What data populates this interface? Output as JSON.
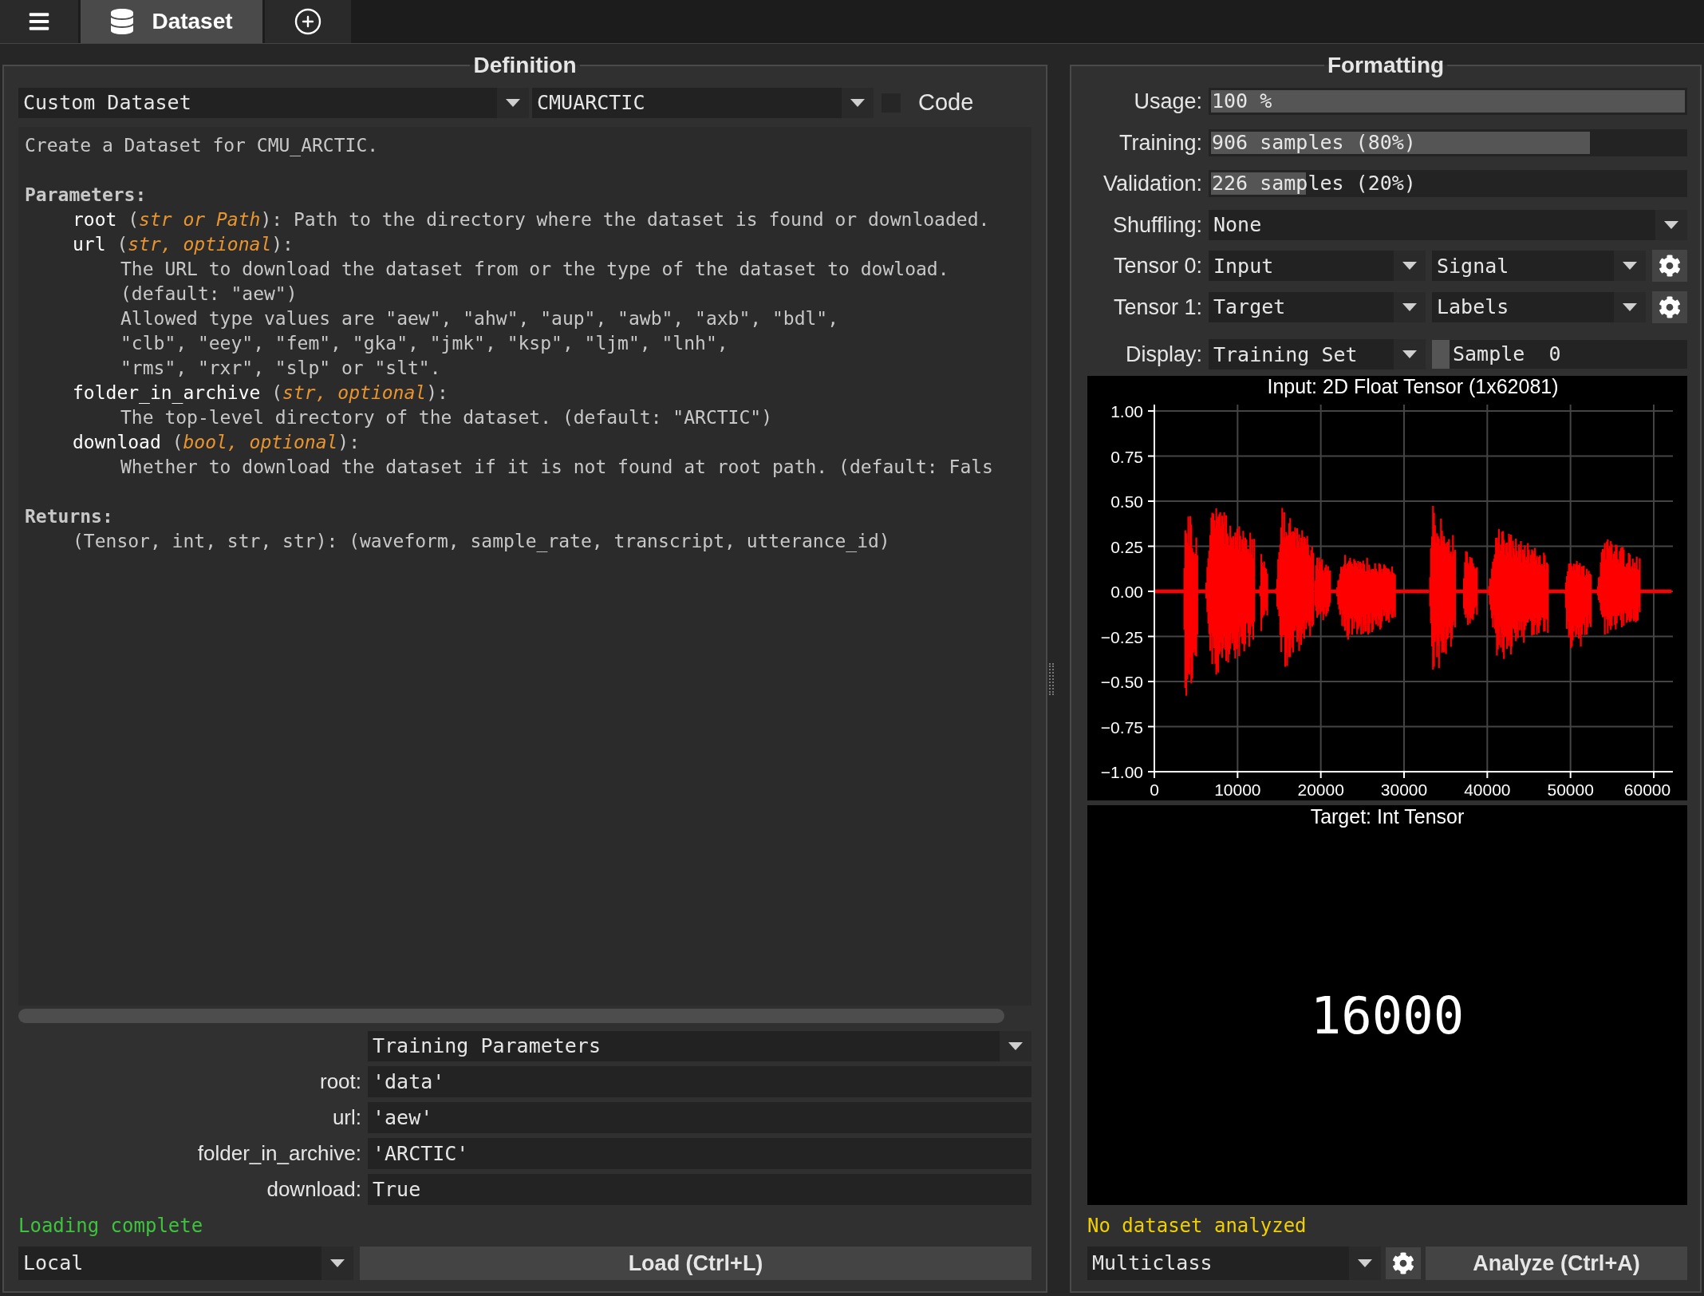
{
  "toolbar": {
    "tabs": [
      {
        "label": "Dataset",
        "selected": true
      }
    ]
  },
  "definition": {
    "title": "Definition",
    "dataset_type": "Custom Dataset",
    "dataset": "CMUARCTIC",
    "code": {
      "label": "Code",
      "checked": false
    },
    "docstring": [
      {
        "parts": [
          {
            "kind": "plain",
            "text": "Create a Dataset for CMU_ARCTIC."
          }
        ]
      },
      {
        "gap_before": true,
        "parts": [
          {
            "kind": "heading",
            "text": "Parameters:"
          }
        ],
        "children": [
          {
            "parts": [
              {
                "kind": "name",
                "text": "root"
              },
              {
                "kind": "plain",
                "text": " ("
              },
              {
                "kind": "type",
                "text": "str or Path"
              },
              {
                "kind": "plain",
                "text": "): Path to the directory where the dataset is found or downloaded."
              }
            ]
          },
          {
            "parts": [
              {
                "kind": "name",
                "text": "url"
              },
              {
                "kind": "plain",
                "text": " ("
              },
              {
                "kind": "type",
                "text": "str, optional"
              },
              {
                "kind": "plain",
                "text": "):"
              }
            ],
            "children": [
              {
                "parts": [
                  {
                    "kind": "plain",
                    "text": "The URL to download the dataset from or the type of the dataset to dowload."
                  }
                ]
              },
              {
                "parts": [
                  {
                    "kind": "plain",
                    "text": "(default: \"aew\")"
                  }
                ]
              },
              {
                "parts": [
                  {
                    "kind": "plain",
                    "text": "Allowed type values are \"aew\", \"ahw\", \"aup\", \"awb\", \"axb\", \"bdl\","
                  }
                ]
              },
              {
                "parts": [
                  {
                    "kind": "plain",
                    "text": "\"clb\", \"eey\", \"fem\", \"gka\", \"jmk\", \"ksp\", \"ljm\", \"lnh\","
                  }
                ]
              },
              {
                "parts": [
                  {
                    "kind": "plain",
                    "text": "\"rms\", \"rxr\", \"slp\" or \"slt\"."
                  }
                ]
              }
            ]
          },
          {
            "parts": [
              {
                "kind": "name",
                "text": "folder_in_archive"
              },
              {
                "kind": "plain",
                "text": " ("
              },
              {
                "kind": "type",
                "text": "str, optional"
              },
              {
                "kind": "plain",
                "text": "):"
              }
            ],
            "children": [
              {
                "parts": [
                  {
                    "kind": "plain",
                    "text": "The top-level directory of the dataset. (default: \"ARCTIC\")"
                  }
                ]
              }
            ]
          },
          {
            "parts": [
              {
                "kind": "name",
                "text": "download"
              },
              {
                "kind": "plain",
                "text": " ("
              },
              {
                "kind": "type",
                "text": "bool, optional"
              },
              {
                "kind": "plain",
                "text": "):"
              }
            ],
            "children": [
              {
                "parts": [
                  {
                    "kind": "plain",
                    "text": "Whether to download the dataset if it is not found at root path. (default: Fals"
                  }
                ]
              }
            ]
          }
        ]
      },
      {
        "gap_before": true,
        "parts": [
          {
            "kind": "heading",
            "text": "Returns:"
          }
        ],
        "children": [
          {
            "parts": [
              {
                "kind": "plain",
                "text": "(Tensor, int, str, str): (waveform, sample_rate, transcript, utterance_id)"
              }
            ]
          }
        ]
      }
    ],
    "parameter_set": "Training Parameters",
    "parameters": [
      {
        "label": "root:",
        "value": "'data'"
      },
      {
        "label": "url:",
        "value": "'aew'"
      },
      {
        "label": "folder_in_archive:",
        "value": "'ARCTIC'"
      },
      {
        "label": "download:",
        "value": "True"
      }
    ],
    "status": "Loading complete",
    "source": "Local",
    "load_button": "Load (Ctrl+L)"
  },
  "formatting": {
    "title": "Formatting",
    "bars": [
      {
        "label": "Usage:",
        "text": "100 %",
        "level": 1
      },
      {
        "label": "Training:",
        "text": "906 samples (80%)",
        "level": 0.8
      },
      {
        "label": "Validation:",
        "text": "226 samples (20%)",
        "level": 0.2
      }
    ],
    "shuffling": {
      "label": "Shuffling:",
      "value": "None"
    },
    "tensors": [
      {
        "label": "Tensor 0:",
        "role": "Input",
        "type": "Signal"
      },
      {
        "label": "Tensor 1:",
        "role": "Target",
        "type": "Labels"
      }
    ],
    "display": {
      "label": "Display:",
      "set": "Training Set",
      "sample": "Sample  0",
      "level": 0
    },
    "input_plot": {
      "title": "Input: 2D Float Tensor (1x62081)",
      "y_labels": [
        "1.00",
        "0.75",
        "0.50",
        "0.25",
        "0.00",
        "−0.25",
        "−0.50",
        "−0.75",
        "−1.00"
      ],
      "x_labels": [
        "0",
        "10000",
        "20000",
        "30000",
        "40000",
        "50000",
        "60000"
      ]
    },
    "target_plot": {
      "title": "Target: Int Tensor",
      "value": "16000"
    },
    "status": "No dataset analyzed",
    "task": "Multiclass",
    "analyze_button": "Analyze (Ctrl+A)"
  }
}
